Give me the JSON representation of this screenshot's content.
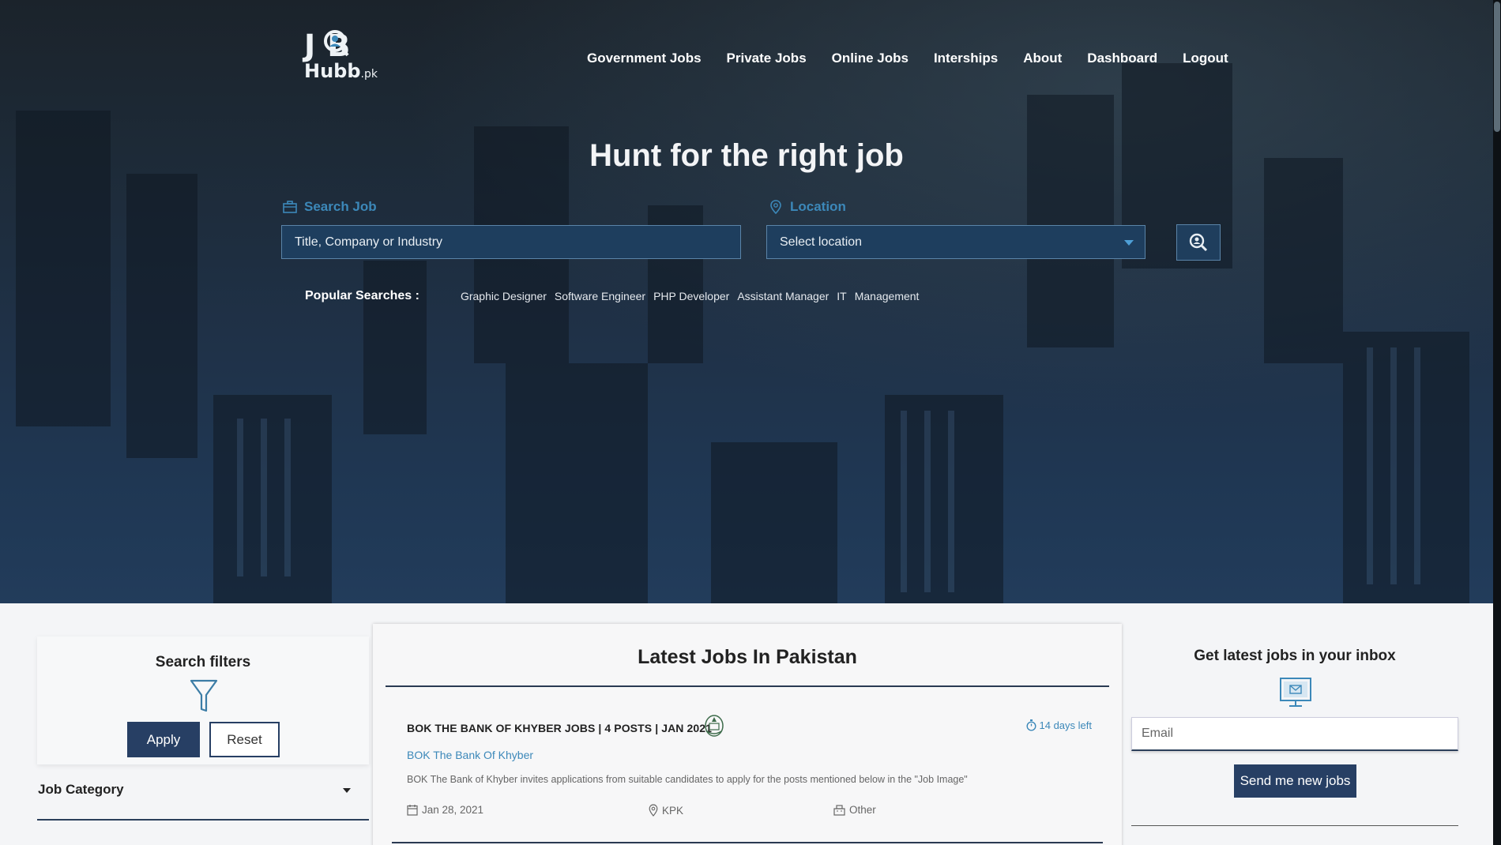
{
  "brand": {
    "logo_top": "J B",
    "logo_bottom": "Hubb",
    "logo_suffix": ".pk"
  },
  "nav": {
    "items": [
      "Government Jobs",
      "Private Jobs",
      "Online Jobs",
      "Interships",
      "About",
      "Dashboard",
      "Logout"
    ]
  },
  "hero": {
    "title": "Hunt for the right job",
    "search_label": "Search Job",
    "search_placeholder": "Title, Company or Industry",
    "location_label": "Location",
    "location_selected": "Select location",
    "popular_label": "Popular Searches :",
    "popular_tags": [
      "Graphic Designer",
      "Software Engineer",
      "PHP Developer",
      "Assistant Manager",
      "IT",
      "Management"
    ]
  },
  "filters": {
    "title": "Search filters",
    "apply_label": "Apply",
    "reset_label": "Reset",
    "job_category_label": "Job Category"
  },
  "latest": {
    "title": "Latest Jobs In Pakistan",
    "jobs": [
      {
        "title": "BOK THE BANK OF KHYBER JOBS | 4 POSTS | JAN 2021",
        "days_left": "14 days left",
        "company": "BOK The Bank Of Khyber",
        "description": "BOK The Bank of Khyber invites applications from suitable candidates to apply for the posts mentioned below in the \"Job Image\"",
        "date": "Jan 28, 2021",
        "location": "KPK",
        "type": "Other"
      }
    ]
  },
  "inbox": {
    "title": "Get latest jobs in your inbox",
    "email_placeholder": "Email",
    "send_label": "Send me new jobs"
  },
  "colors": {
    "accent": "#3c88b9",
    "primary": "#273f64",
    "hero_bg": "#1f3147"
  }
}
